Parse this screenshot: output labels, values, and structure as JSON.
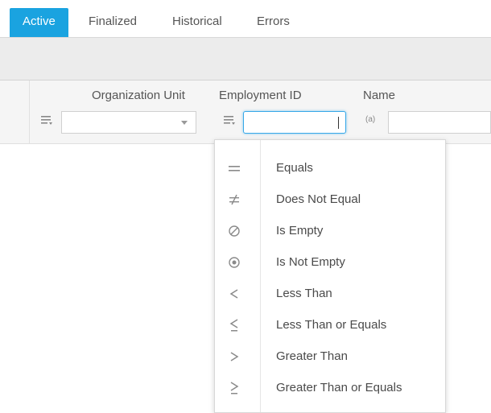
{
  "tabs": [
    {
      "label": "Active",
      "active": true
    },
    {
      "label": "Finalized",
      "active": false
    },
    {
      "label": "Historical",
      "active": false
    },
    {
      "label": "Errors",
      "active": false
    }
  ],
  "columns": [
    {
      "label": "Organization Unit",
      "filter_type": "dropdown",
      "value": ""
    },
    {
      "label": "Employment ID",
      "filter_type": "text",
      "value": ""
    },
    {
      "label": "Name",
      "filter_type": "text",
      "value": ""
    }
  ],
  "name_filter_icon": "(a)",
  "operators": [
    {
      "label": "Equals",
      "icon": "equals-icon"
    },
    {
      "label": "Does Not Equal",
      "icon": "not-equal-icon"
    },
    {
      "label": "Is Empty",
      "icon": "empty-set-icon"
    },
    {
      "label": "Is Not Empty",
      "icon": "not-empty-icon"
    },
    {
      "label": "Less Than",
      "icon": "less-than-icon"
    },
    {
      "label": "Less Than or Equals",
      "icon": "less-than-equal-icon"
    },
    {
      "label": "Greater Than",
      "icon": "greater-than-icon"
    },
    {
      "label": "Greater Than or Equals",
      "icon": "greater-than-equal-icon"
    }
  ],
  "colors": {
    "accent": "#1aa3e0",
    "focus": "#37a8e8"
  }
}
